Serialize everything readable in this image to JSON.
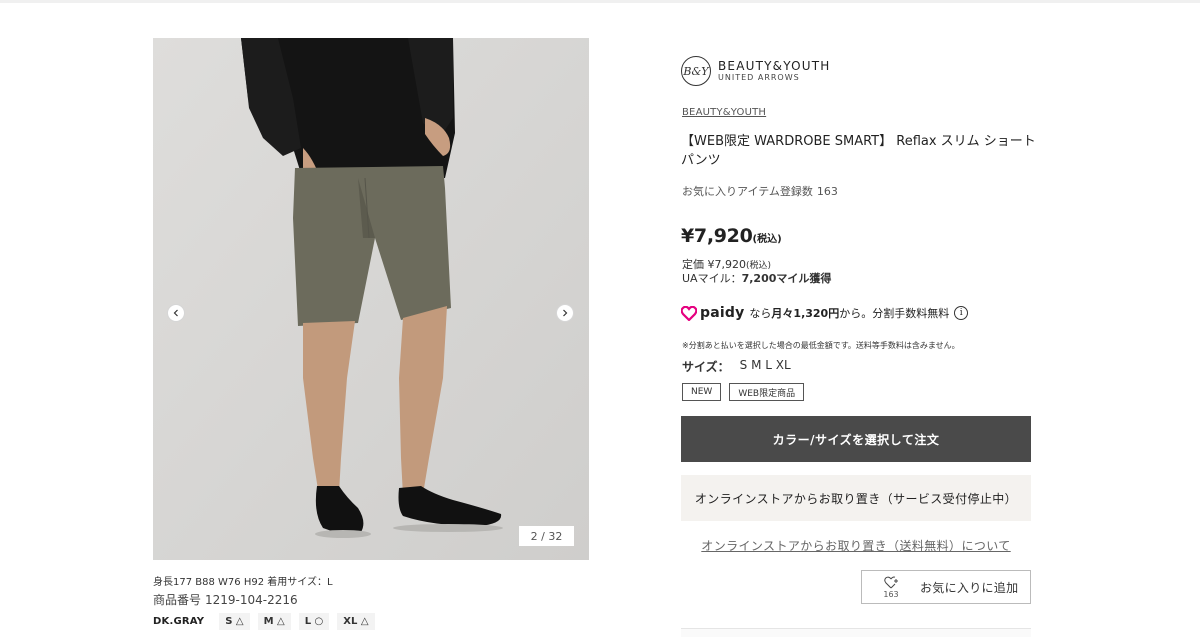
{
  "gallery": {
    "counter": "2 / 32",
    "model_info": "身長177 B88 W76 H92 着用サイズ：L",
    "product_number_label": "商品番号",
    "product_number": "1219-104-2216",
    "color_name": "DK.GRAY",
    "sizes": [
      "S △",
      "M △",
      "L ○",
      "XL △"
    ]
  },
  "brand": {
    "logo_mark": "B&Y",
    "logo_line1": "BEAUTY&YOUTH",
    "logo_line2": "UNITED ARROWS",
    "link_text": "BEAUTY&YOUTH"
  },
  "product": {
    "title": "【WEB限定 WARDROBE SMART】 Reflax スリム ショートパンツ",
    "favorite_label": "お気に入りアイテム登録数",
    "favorite_count": "163"
  },
  "price": {
    "main": "¥7,920",
    "main_tax": "(税込)",
    "list_label": "定価 ¥7,920",
    "list_tax": "(税込)",
    "miles_label": "UAマイル：",
    "miles_value": "7,200マイル獲得"
  },
  "paidy": {
    "logo_word": "paidy",
    "text_prefix": "なら",
    "text_amount": "月々1,320円",
    "text_suffix": "から。分割手数料無料",
    "info_glyph": "i",
    "note": "※分割あと払いを選択した場合の最低金額です。送料等手数料は含みません。"
  },
  "sizes": {
    "label": "サイズ：",
    "values": "S M L XL"
  },
  "tags": [
    "NEW",
    "WEB限定商品"
  ],
  "actions": {
    "order_button": "カラー/サイズを選択して注文",
    "pickup_button": "オンラインストアからお取り置き（サービス受付停止中）",
    "pickup_link": "オンラインストアからお取り置き（送料無料）について",
    "favorite_button": "お気に入りに追加",
    "favorite_button_count": "163"
  },
  "colors": {
    "order_button_bg": "#4a4a4a",
    "pickup_button_bg": "#f4f2ef",
    "paidy_magenta": "#e5007f"
  }
}
